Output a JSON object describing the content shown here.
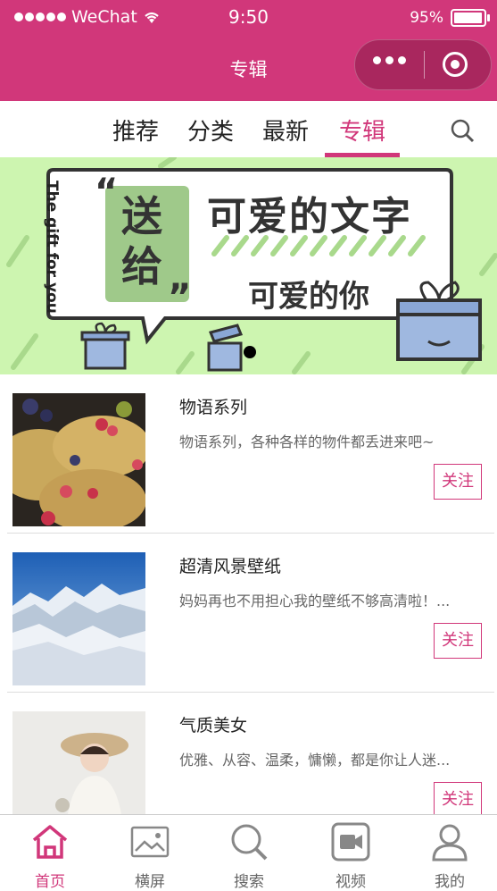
{
  "status_bar": {
    "carrier": "WeChat",
    "time": "9:50",
    "battery": "95%"
  },
  "nav": {
    "title": "专辑"
  },
  "tabs": [
    {
      "label": "推荐"
    },
    {
      "label": "分类"
    },
    {
      "label": "最新"
    },
    {
      "label": "专辑"
    }
  ],
  "banner": {
    "vertical_text": "The gift for you",
    "send_text": "送给",
    "headline": "可爱的文字",
    "subline": "可爱的你"
  },
  "albums": [
    {
      "title": "物语系列",
      "desc": "物语系列，各种各样的物件都丢进来吧~",
      "follow": "关注"
    },
    {
      "title": "超清风景壁纸",
      "desc": "妈妈再也不用担心我的壁纸不够高清啦！...",
      "follow": "关注"
    },
    {
      "title": "气质美女",
      "desc": "优雅、从容、温柔，慵懒，都是你让人迷...",
      "follow": "关注"
    }
  ],
  "tabbar": [
    {
      "label": "首页",
      "icon": "home-icon"
    },
    {
      "label": "横屏",
      "icon": "landscape-image-icon"
    },
    {
      "label": "搜索",
      "icon": "search-icon"
    },
    {
      "label": "视频",
      "icon": "video-icon"
    },
    {
      "label": "我的",
      "icon": "user-icon"
    }
  ],
  "colors": {
    "accent": "#d1377a",
    "banner_bg": "#cdf5b0"
  }
}
